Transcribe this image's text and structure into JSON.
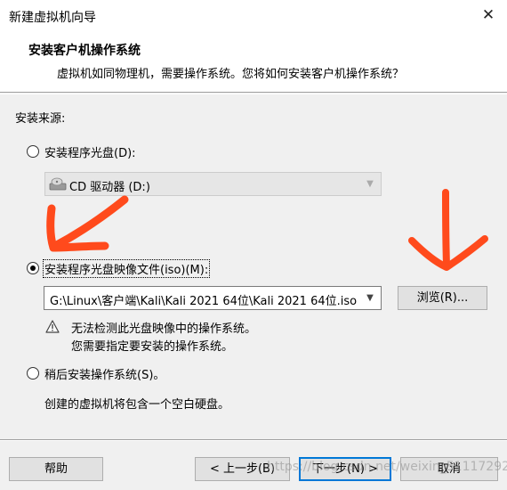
{
  "window": {
    "title": "新建虚拟机向导",
    "close_glyph": "✕"
  },
  "header": {
    "heading": "安装客户机操作系统",
    "description": "虚拟机如同物理机，需要操作系统。您将如何安装客户机操作系统？"
  },
  "install_source": {
    "label": "安装来源:",
    "disc_option": {
      "label": "安装程序光盘(D):",
      "selected": false
    },
    "drive_combo": {
      "value": "CD 驱动器 (D:)",
      "disabled": true
    },
    "iso_option": {
      "label": "安装程序光盘映像文件(iso)(M):",
      "selected": true
    },
    "iso_combo": {
      "value": "G:\\Linux\\客户端\\Kali\\Kali 2021 64位\\Kali 2021 64位.iso"
    },
    "browse_label": "浏览(R)...",
    "warning_line1": "无法检测此光盘映像中的操作系统。",
    "warning_line2": "您需要指定要安装的操作系统。",
    "later_option": {
      "label": "稍后安装操作系统(S)。",
      "selected": false
    },
    "later_description": "创建的虚拟机将包含一个空白硬盘。"
  },
  "footer": {
    "help_label": "帮助",
    "back_label": "< 上一步(B)",
    "next_label": "下一步(N) >",
    "cancel_label": "取消"
  },
  "watermark": "https://blog.csdn.net/weixin_51117292",
  "colors": {
    "annotation_arrow": "#ff4a1c",
    "default_button_border": "#0078d7"
  }
}
